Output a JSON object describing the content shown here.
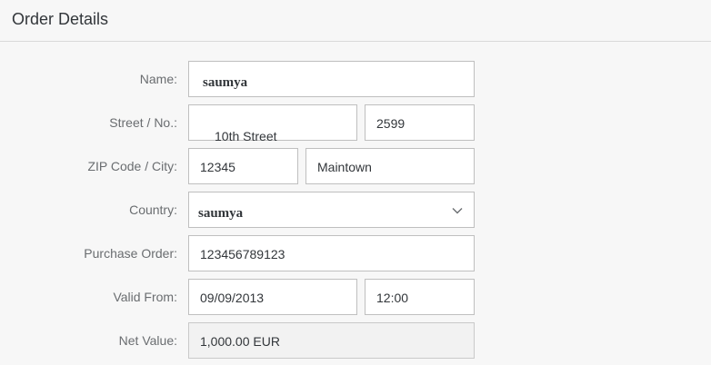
{
  "header": {
    "title": "Order Details"
  },
  "form": {
    "name": {
      "label": "Name:",
      "value": "saumya"
    },
    "street": {
      "label": "Street / No.:",
      "street_value": "10th Street",
      "number_value": "2599"
    },
    "zip_city": {
      "label": "ZIP Code / City:",
      "zip_value": "12345",
      "city_value": "Maintown"
    },
    "country": {
      "label": "Country:",
      "value": "saumya"
    },
    "purchase_order": {
      "label": "Purchase Order:",
      "value": "123456789123"
    },
    "valid_from": {
      "label": "Valid From:",
      "date_value": "09/09/2013",
      "time_value": "12:00"
    },
    "net_value": {
      "label": "Net Value:",
      "value": "1,000.00 EUR"
    }
  },
  "icons": {
    "country_dropdown": "chevron-down-icon"
  },
  "colors": {
    "background": "#f7f7f7",
    "field_border": "#bfbfbf",
    "label_text": "#6a6d70",
    "value_text": "#32363a",
    "readonly_bg": "#f2f2f2"
  }
}
